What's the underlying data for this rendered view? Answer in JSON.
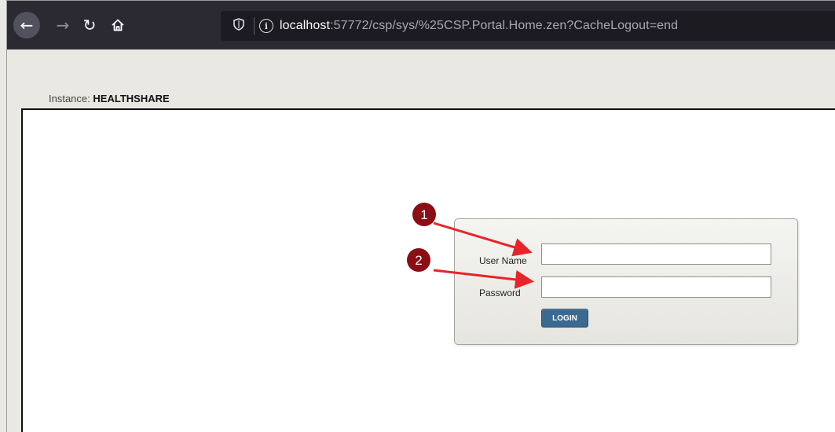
{
  "browser": {
    "url_host": "localhost",
    "url_rest": ":57772/csp/sys/%25CSP.Portal.Home.zen?CacheLogout=end",
    "icons": {
      "back": "arrow-left-icon",
      "forward": "arrow-right-icon",
      "reload": "reload-icon",
      "home": "home-icon",
      "shield": "shield-icon",
      "info": "info-icon"
    }
  },
  "page": {
    "instance_label": "Instance:",
    "instance_name": "HEALTHSHARE"
  },
  "login": {
    "username_label": "User Name",
    "password_label": "Password",
    "username_value": "",
    "password_value": "",
    "button_label": "LOGIN"
  },
  "annotations": {
    "callout_1": "1",
    "callout_2": "2",
    "callout_color": "#8b0e14",
    "arrow_color": "#e8232a"
  },
  "colors": {
    "toolbar": "#2b2a33",
    "urlbar": "#1c1b22",
    "page_bg": "#e9e8e3",
    "login_button": "#3a6a8f"
  }
}
